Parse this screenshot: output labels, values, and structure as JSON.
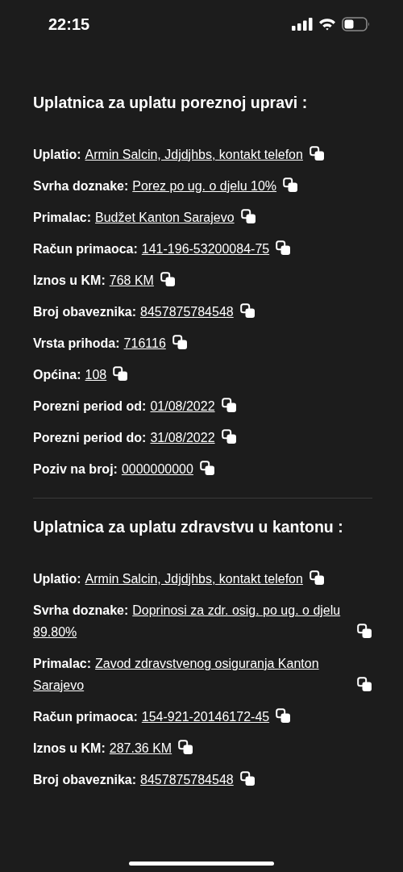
{
  "status_bar": {
    "time": "22:15"
  },
  "sections": [
    {
      "title": "Uplatnica za uplatu poreznoj upravi :",
      "fields": [
        {
          "label": "Uplatio:",
          "value": "Armin Salcin, Jdjdjhbs, kontakt telefon"
        },
        {
          "label": "Svrha doznake:",
          "value": "Porez po ug. o djelu 10%"
        },
        {
          "label": "Primalac:",
          "value": "Budžet Kanton Sarajevo"
        },
        {
          "label": "Račun primaoca:",
          "value": "141-196-53200084-75"
        },
        {
          "label": "Iznos u KM:",
          "value": "768 KM"
        },
        {
          "label": "Broj obaveznika:",
          "value": "8457875784548"
        },
        {
          "label": "Vrsta prihoda:",
          "value": "716116"
        },
        {
          "label": "Općina:",
          "value": "108"
        },
        {
          "label": "Porezni period od:",
          "value": "01/08/2022"
        },
        {
          "label": "Porezni period do:",
          "value": "31/08/2022"
        },
        {
          "label": "Poziv na broj:",
          "value": "0000000000"
        }
      ]
    },
    {
      "title": "Uplatnica za uplatu zdravstvu u kantonu :",
      "fields": [
        {
          "label": "Uplatio:",
          "value": "Armin Salcin, Jdjdjhbs, kontakt telefon"
        },
        {
          "label": "Svrha doznake:",
          "value": "Doprinosi za zdr. osig. po ug. o djelu 89.80%"
        },
        {
          "label": "Primalac:",
          "value": "Zavod zdravstvenog osiguranja Kanton Sarajevo"
        },
        {
          "label": "Račun primaoca:",
          "value": "154-921-20146172-45"
        },
        {
          "label": "Iznos u KM:",
          "value": "287.36 KM"
        },
        {
          "label": "Broj obaveznika:",
          "value": "8457875784548"
        }
      ]
    }
  ]
}
